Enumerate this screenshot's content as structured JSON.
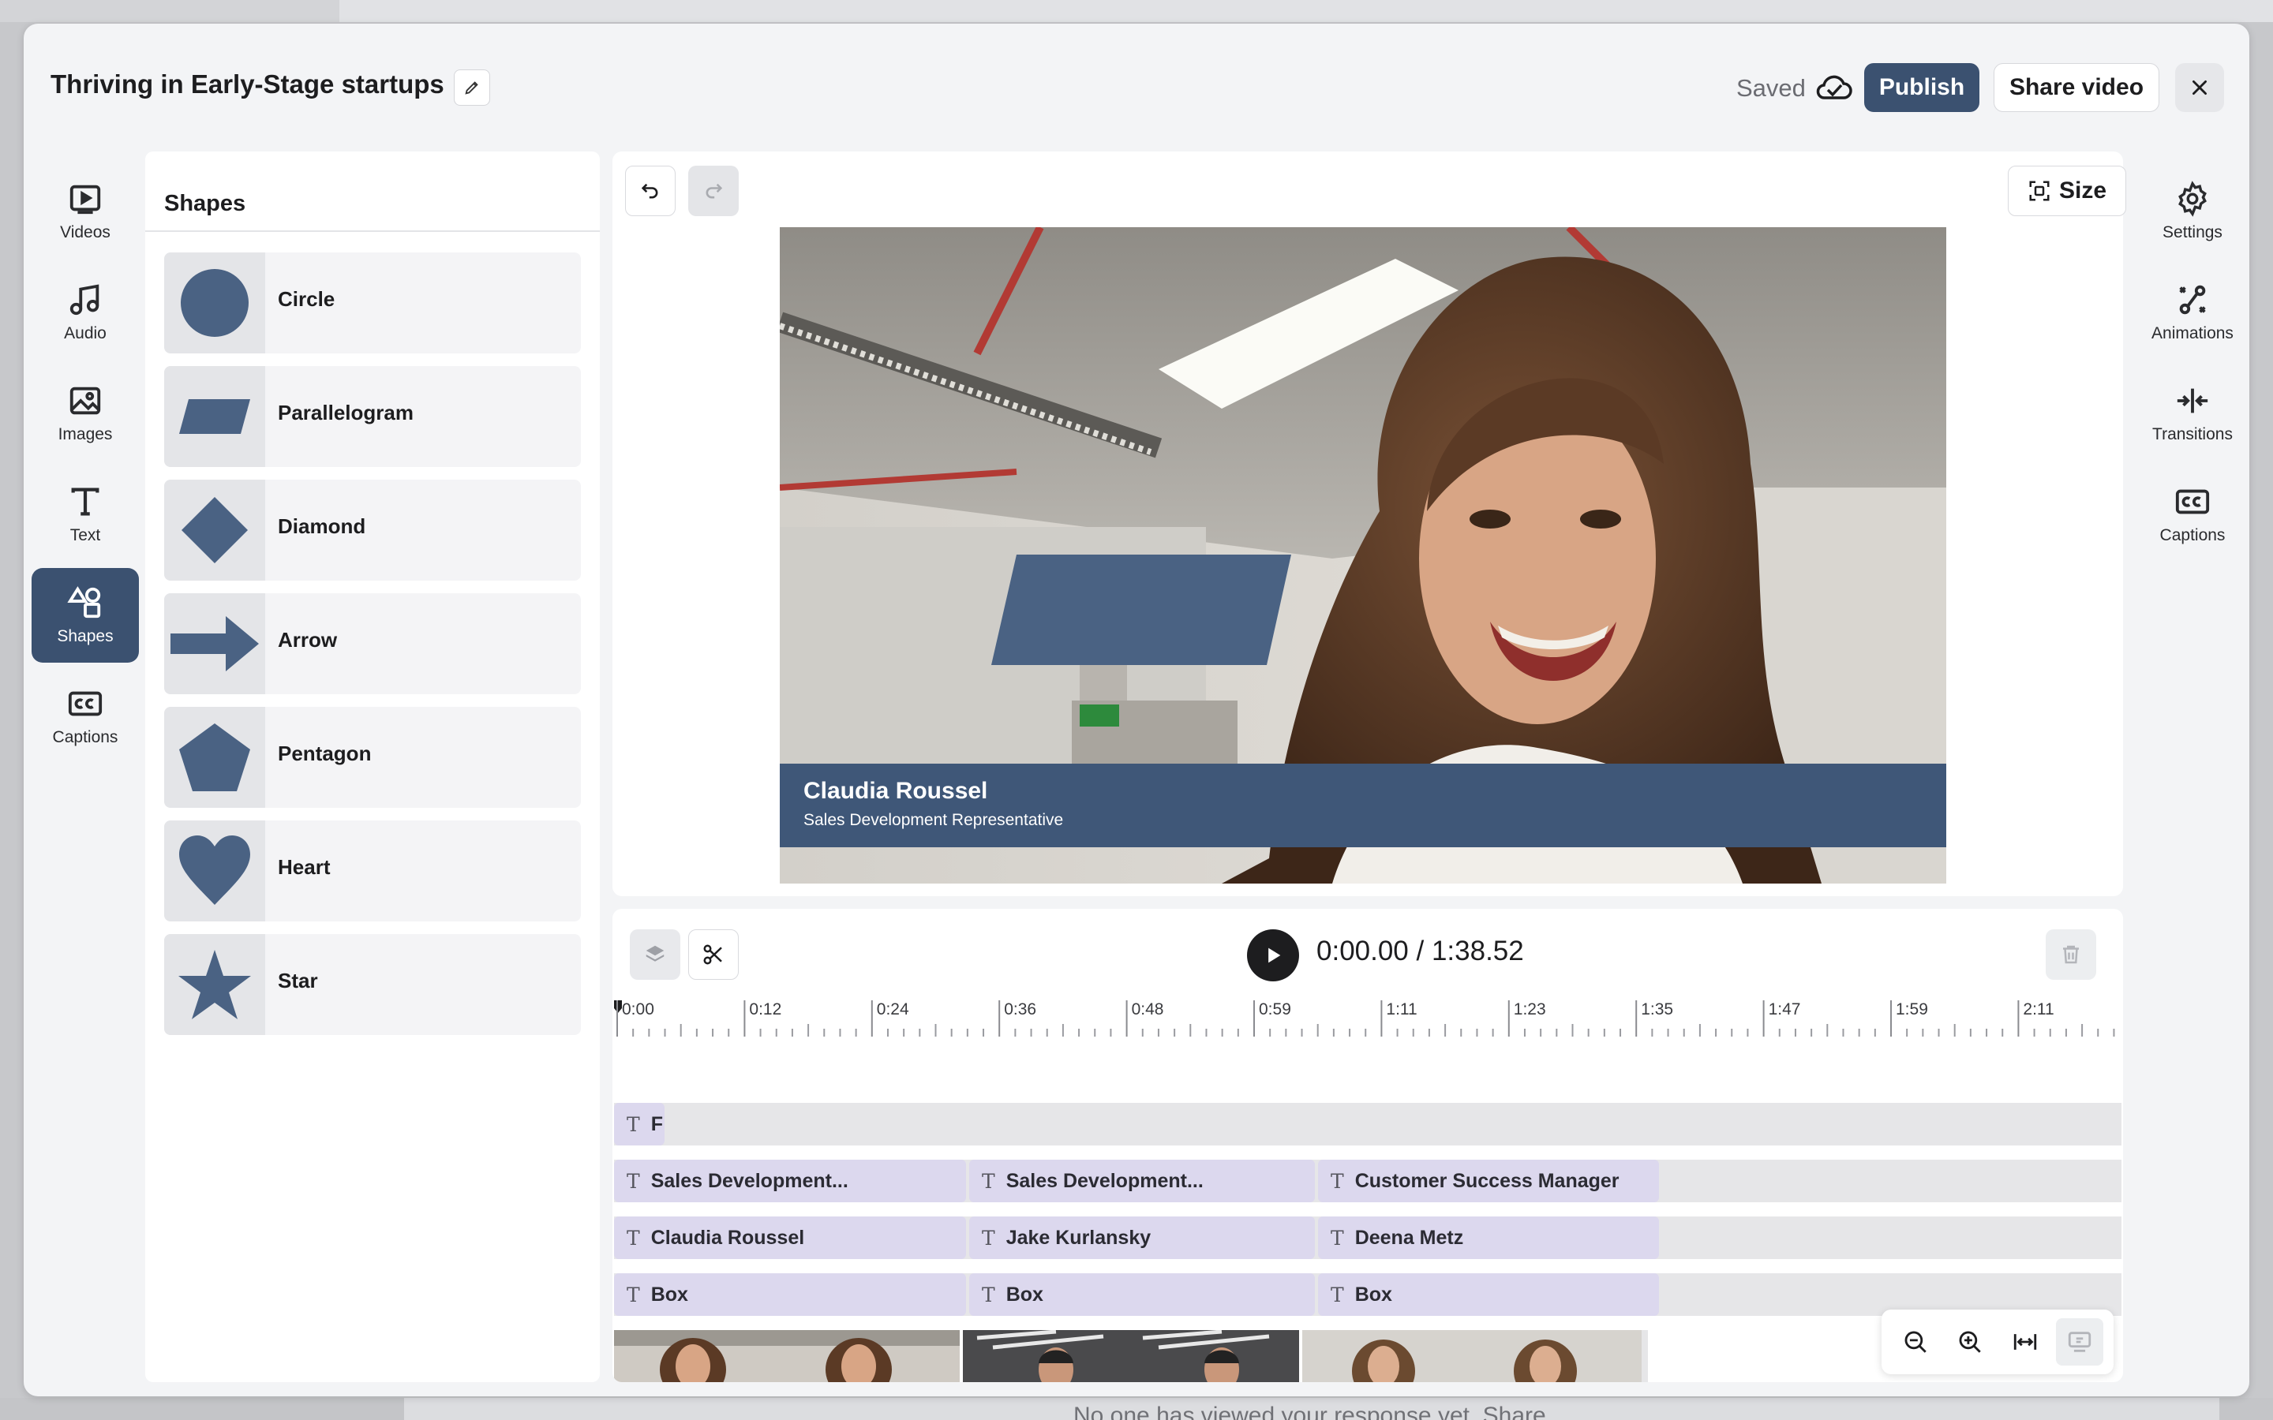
{
  "header": {
    "title": "Thriving in Early-Stage startups",
    "saved_label": "Saved",
    "publish_label": "Publish",
    "share_label": "Share video"
  },
  "left_rail": [
    {
      "label": "Videos",
      "icon": "video-icon"
    },
    {
      "label": "Audio",
      "icon": "music-note-icon"
    },
    {
      "label": "Images",
      "icon": "image-icon"
    },
    {
      "label": "Text",
      "icon": "text-icon"
    },
    {
      "label": "Shapes",
      "icon": "shapes-icon",
      "active": true
    },
    {
      "label": "Captions",
      "icon": "closed-captions-icon"
    }
  ],
  "right_rail": [
    {
      "label": "Settings",
      "icon": "gear-icon"
    },
    {
      "label": "Animations",
      "icon": "animations-icon"
    },
    {
      "label": "Transitions",
      "icon": "transitions-icon"
    },
    {
      "label": "Captions",
      "icon": "closed-captions-icon"
    }
  ],
  "shapes_panel": {
    "title": "Shapes",
    "items": [
      "Circle",
      "Parallelogram",
      "Diamond",
      "Arrow",
      "Pentagon",
      "Heart",
      "Star"
    ]
  },
  "preview": {
    "size_label": "Size",
    "lower_third_name": "Claudia Roussel",
    "lower_third_role": "Sales Development Representative"
  },
  "timeline": {
    "current_time": "0:00.00 / 1:38.52",
    "ticks": [
      "0:00",
      "0:12",
      "0:24",
      "0:36",
      "0:48",
      "0:59",
      "1:11",
      "1:23",
      "1:35",
      "1:47",
      "1:59",
      "2:11"
    ],
    "top_track_clip": "F",
    "tracks": [
      [
        "Sales Development...",
        "Sales Development...",
        "Customer Success Manager"
      ],
      [
        "Claudia Roussel",
        "Jake Kurlansky",
        "Deena Metz"
      ],
      [
        "Box",
        "Box",
        "Box"
      ]
    ]
  },
  "background": {
    "footer_text": "No one has viewed your response yet. Share"
  },
  "colors": {
    "accent": "#3b5170",
    "shape_fill": "#4a6283",
    "clip_fill": "#dcd8ee"
  }
}
